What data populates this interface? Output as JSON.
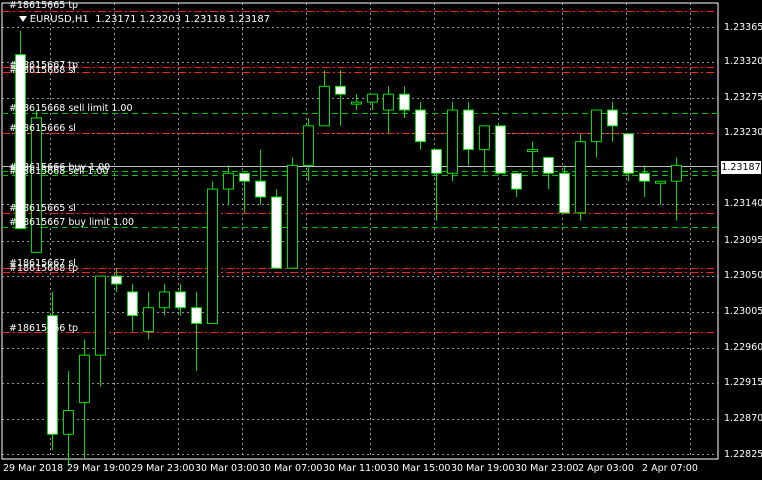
{
  "header": {
    "symbol": "EURUSD,H1",
    "ohlc": "1.23171 1.23203 1.23118 1.23187"
  },
  "current_price": "1.23187",
  "colors": {
    "background": "#000000",
    "grid": "#c8c8c8",
    "bull_body": "#000000",
    "bear_body": "#ffffff",
    "wick": "#00e000",
    "order_green": "#00c000",
    "order_red": "#ff2020",
    "bid_line": "#c0c0c0"
  },
  "order_labels": [
    {
      "text": "#18615665 tp"
    },
    {
      "text": "#18615667 tp"
    },
    {
      "text": "#18615668 sl"
    },
    {
      "text": "#18615668 sell limit 1.00"
    },
    {
      "text": "#18615666 sl"
    },
    {
      "text": "#18615666 buy 1.00"
    },
    {
      "text": "#18615668 sell 1.00"
    },
    {
      "text": "#18615665 sl"
    },
    {
      "text": "#18615667 buy limit 1.00"
    },
    {
      "text": "#18615667 sl"
    },
    {
      "text": "#18615668 tp"
    },
    {
      "text": "#18615666 tp"
    }
  ],
  "chart_data": {
    "type": "candlestick",
    "symbol": "EURUSD",
    "timeframe": "H1",
    "y_ticks": [
      "1.23365",
      "1.23320",
      "1.23275",
      "1.23230",
      "1.23187",
      "1.23140",
      "1.23095",
      "1.23050",
      "1.23005",
      "1.22960",
      "1.22915",
      "1.22870",
      "1.22825"
    ],
    "x_ticks": [
      "29 Mar 2018",
      "29 Mar 19:00",
      "29 Mar 23:00",
      "30 Mar 03:00",
      "30 Mar 07:00",
      "30 Mar 11:00",
      "30 Mar 15:00",
      "30 Mar 19:00",
      "30 Mar 23:00",
      "2 Apr 03:00",
      "2 Apr 07:00"
    ],
    "ylim": [
      1.2282,
      1.2339
    ],
    "candles": [
      {
        "o": 1.2333,
        "h": 1.2336,
        "l": 1.2311,
        "c": 1.2311
      },
      {
        "o": 1.2308,
        "h": 1.2326,
        "l": 1.2308,
        "c": 1.2325
      },
      {
        "o": 1.23,
        "h": 1.2303,
        "l": 1.2283,
        "c": 1.2285
      },
      {
        "o": 1.2285,
        "h": 1.2293,
        "l": 1.2281,
        "c": 1.2288
      },
      {
        "o": 1.2289,
        "h": 1.2297,
        "l": 1.2282,
        "c": 1.2295
      },
      {
        "o": 1.2295,
        "h": 1.2305,
        "l": 1.2291,
        "c": 1.2305
      },
      {
        "o": 1.2305,
        "h": 1.2306,
        "l": 1.2303,
        "c": 1.2304
      },
      {
        "o": 1.2303,
        "h": 1.2304,
        "l": 1.2298,
        "c": 1.23
      },
      {
        "o": 1.2298,
        "h": 1.2303,
        "l": 1.2297,
        "c": 1.2301
      },
      {
        "o": 1.2301,
        "h": 1.2304,
        "l": 1.23,
        "c": 1.2303
      },
      {
        "o": 1.2303,
        "h": 1.2304,
        "l": 1.23,
        "c": 1.2301
      },
      {
        "o": 1.2301,
        "h": 1.2303,
        "l": 1.2293,
        "c": 1.2299
      },
      {
        "o": 1.2299,
        "h": 1.2317,
        "l": 1.2299,
        "c": 1.2316
      },
      {
        "o": 1.2316,
        "h": 1.2319,
        "l": 1.2314,
        "c": 1.2318
      },
      {
        "o": 1.2318,
        "h": 1.2318,
        "l": 1.2313,
        "c": 1.2317
      },
      {
        "o": 1.2317,
        "h": 1.2321,
        "l": 1.2314,
        "c": 1.2315
      },
      {
        "o": 1.2315,
        "h": 1.2316,
        "l": 1.2306,
        "c": 1.2306
      },
      {
        "o": 1.2306,
        "h": 1.232,
        "l": 1.2306,
        "c": 1.2319
      },
      {
        "o": 1.2319,
        "h": 1.2325,
        "l": 1.2317,
        "c": 1.2324
      },
      {
        "o": 1.2324,
        "h": 1.2331,
        "l": 1.2324,
        "c": 1.2329
      },
      {
        "o": 1.2329,
        "h": 1.2331,
        "l": 1.2324,
        "c": 1.2328
      },
      {
        "o": 1.2327,
        "h": 1.2328,
        "l": 1.2326,
        "c": 1.2327
      },
      {
        "o": 1.2327,
        "h": 1.2328,
        "l": 1.2326,
        "c": 1.2328
      },
      {
        "o": 1.2326,
        "h": 1.2329,
        "l": 1.2323,
        "c": 1.2328
      },
      {
        "o": 1.2328,
        "h": 1.2329,
        "l": 1.2325,
        "c": 1.2326
      },
      {
        "o": 1.2326,
        "h": 1.2327,
        "l": 1.2321,
        "c": 1.2322
      },
      {
        "o": 1.2321,
        "h": 1.2321,
        "l": 1.2312,
        "c": 1.2318
      },
      {
        "o": 1.2318,
        "h": 1.2327,
        "l": 1.2317,
        "c": 1.2326
      },
      {
        "o": 1.2326,
        "h": 1.2327,
        "l": 1.2319,
        "c": 1.2321
      },
      {
        "o": 1.2321,
        "h": 1.2324,
        "l": 1.2318,
        "c": 1.2324
      },
      {
        "o": 1.2324,
        "h": 1.2324,
        "l": 1.2318,
        "c": 1.2318
      },
      {
        "o": 1.2318,
        "h": 1.2318,
        "l": 1.2315,
        "c": 1.2316
      },
      {
        "o": 1.2321,
        "h": 1.2322,
        "l": 1.2318,
        "c": 1.2321
      },
      {
        "o": 1.232,
        "h": 1.232,
        "l": 1.2316,
        "c": 1.2318
      },
      {
        "o": 1.2318,
        "h": 1.2319,
        "l": 1.2313,
        "c": 1.2313
      },
      {
        "o": 1.2313,
        "h": 1.2323,
        "l": 1.2312,
        "c": 1.2322
      },
      {
        "o": 1.2322,
        "h": 1.2326,
        "l": 1.232,
        "c": 1.2326
      },
      {
        "o": 1.2326,
        "h": 1.2327,
        "l": 1.2322,
        "c": 1.2324
      },
      {
        "o": 1.2323,
        "h": 1.2323,
        "l": 1.2317,
        "c": 1.2318
      },
      {
        "o": 1.2318,
        "h": 1.2319,
        "l": 1.2315,
        "c": 1.2317
      },
      {
        "o": 1.2317,
        "h": 1.2317,
        "l": 1.2314,
        "c": 1.2317
      },
      {
        "o": 1.2317,
        "h": 1.232,
        "l": 1.2312,
        "c": 1.2319
      }
    ]
  }
}
